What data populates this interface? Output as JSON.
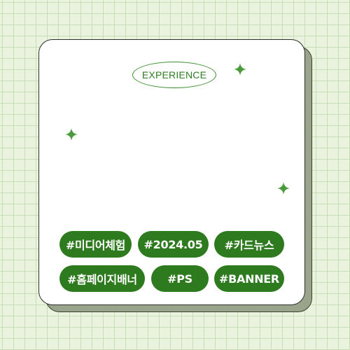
{
  "badge": {
    "label": "EXPERIENCE"
  },
  "tags": [
    {
      "label": "#미디어체험"
    },
    {
      "label": "#2024.05"
    },
    {
      "label": "#카드뉴스"
    },
    {
      "label": "#홈페이지배너"
    },
    {
      "label": "#PS"
    },
    {
      "label": "#BANNER"
    }
  ],
  "colors": {
    "background": "#eaf3de",
    "grid": "#c9ddb5",
    "card": "#ffffff",
    "card_shadow": "#9aa48b",
    "accent_green": "#2e7a1e",
    "sparkle": "#4b9a3c"
  },
  "icons": [
    "sparkle-icon",
    "sparkle-icon",
    "sparkle-icon"
  ]
}
